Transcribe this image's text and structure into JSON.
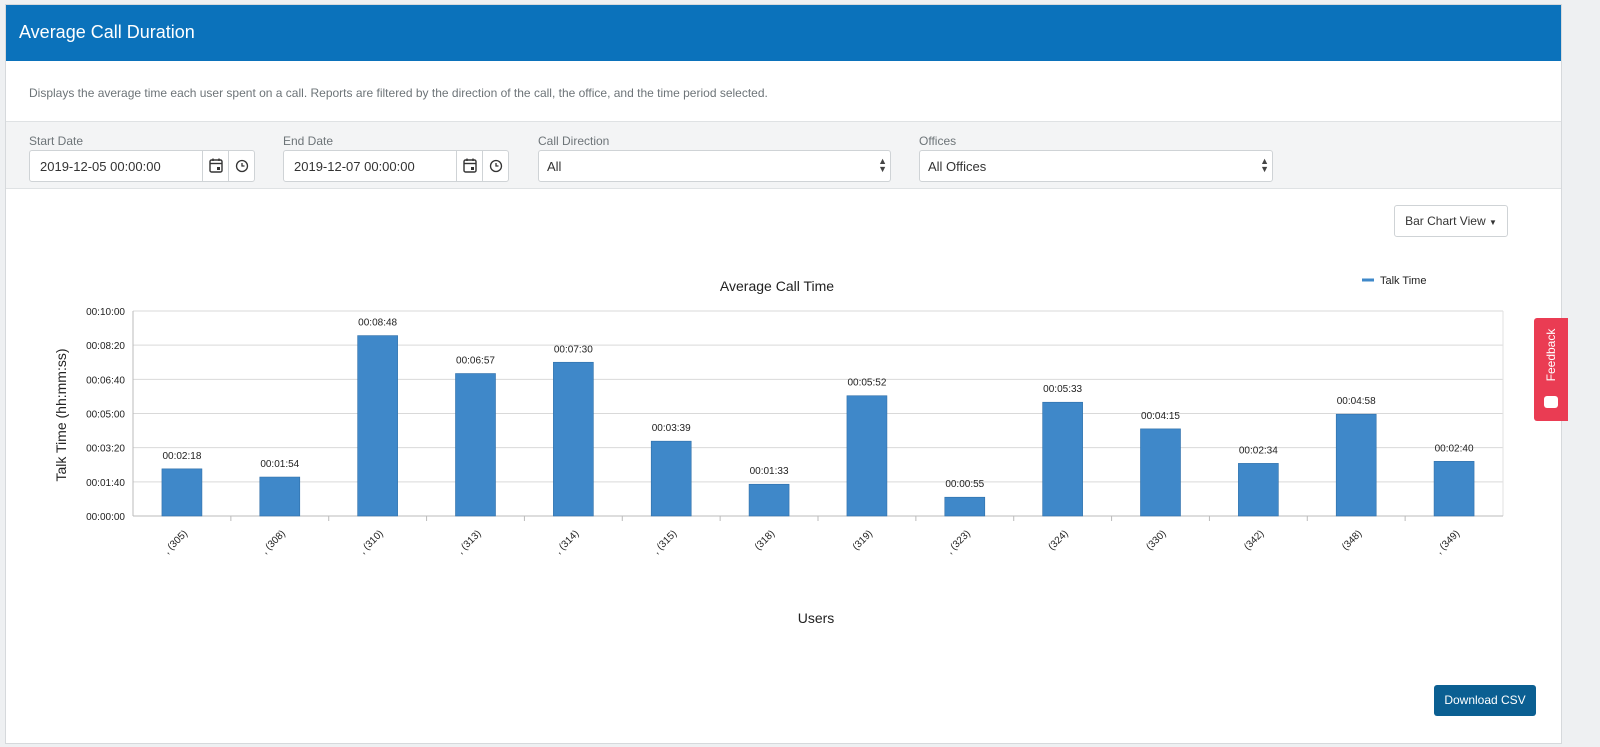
{
  "header": {
    "title": "Average Call Duration"
  },
  "description": "Displays the average time each user spent on a call. Reports are filtered by the direction of the call, the office, and the time period selected.",
  "filters": {
    "start_date": {
      "label": "Start Date",
      "value": "2019-12-05 00:00:00"
    },
    "end_date": {
      "label": "End Date",
      "value": "2019-12-07 00:00:00"
    },
    "call_direction": {
      "label": "Call Direction",
      "value": "All"
    },
    "offices": {
      "label": "Offices",
      "value": "All Offices"
    }
  },
  "view_button": {
    "label": "Bar Chart View"
  },
  "download_button": {
    "label": "Download CSV"
  },
  "feedback": {
    "label": "Feedback"
  },
  "colors": {
    "header": "#0b72bb",
    "bar": "#3f88c9",
    "feedback": "#ea3c53",
    "csv_button": "#0b5f92"
  },
  "chart_data": {
    "type": "bar",
    "title": "Average Call Time",
    "xlabel": "Users",
    "ylabel": "Talk Time (hh:mm:ss)",
    "legend": {
      "entry": "Talk Time",
      "placement": "top-right"
    },
    "categories": [
      ", (305)",
      ", (308)",
      ", (310)",
      ", (313)",
      ", (314)",
      ", (315)",
      "(318)",
      "(319)",
      ", (323)",
      "(324)",
      "(330)",
      "(342)",
      "(348)",
      ", (349)"
    ],
    "series": [
      {
        "name": "Talk Time",
        "values": [
          138,
          114,
          528,
          417,
          450,
          219,
          93,
          352,
          55,
          333,
          255,
          154,
          298,
          160
        ],
        "labels": [
          "00:02:18",
          "00:01:54",
          "00:08:48",
          "00:06:57",
          "00:07:30",
          "00:03:39",
          "00:01:33",
          "00:05:52",
          "00:00:55",
          "00:05:33",
          "00:04:15",
          "00:02:34",
          "00:04:58",
          "00:02:40"
        ]
      }
    ],
    "yticks": [
      "00:00:00",
      "00:01:40",
      "00:03:20",
      "00:05:00",
      "00:06:40",
      "00:08:20",
      "00:10:00"
    ],
    "ytick_values": [
      0,
      100,
      200,
      300,
      400,
      500,
      600
    ],
    "ylim": [
      0,
      600
    ],
    "grid": true
  }
}
